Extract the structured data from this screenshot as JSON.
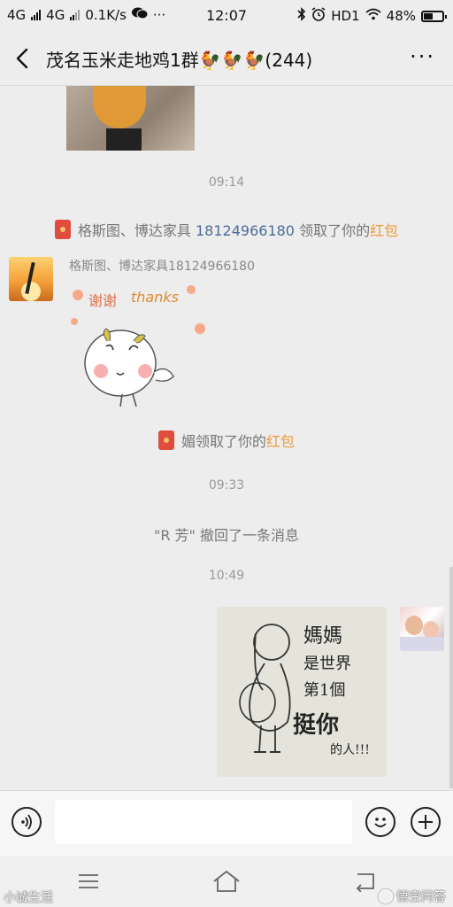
{
  "status_bar": {
    "network1": "4G",
    "network2": "4G",
    "speed": "0.1K/s",
    "dots": "···",
    "time": "12:07",
    "hd": "HD1",
    "battery": "48%",
    "battery_level": 0.48
  },
  "header": {
    "title": "茂名玉米走地鸡1群🐓🐓🐓(244)",
    "more": "···"
  },
  "chat": {
    "time1": "09:14",
    "sys1": {
      "prefix": "格斯图、博达家具",
      "phone": "18124966180",
      "middle": "领取了你的",
      "highlight": "红包"
    },
    "sender_name": "格斯图、博达家具18124966180",
    "sticker_text": {
      "xiexie": "谢谢",
      "thanks": "thanks"
    },
    "sys2": {
      "prefix": "媚领取了你的",
      "highlight": "红包"
    },
    "time2": "09:33",
    "recall": "\"R 芳\" 撤回了一条消息",
    "time3": "10:49",
    "image_text": {
      "l1": "媽媽",
      "l2": "是世界",
      "l3": "第1個",
      "l4": "挺你",
      "l5": "的人!!!"
    }
  },
  "input_bar": {
    "placeholder": ""
  },
  "watermark": {
    "left": "小诚生活",
    "right": "悟空问答"
  }
}
